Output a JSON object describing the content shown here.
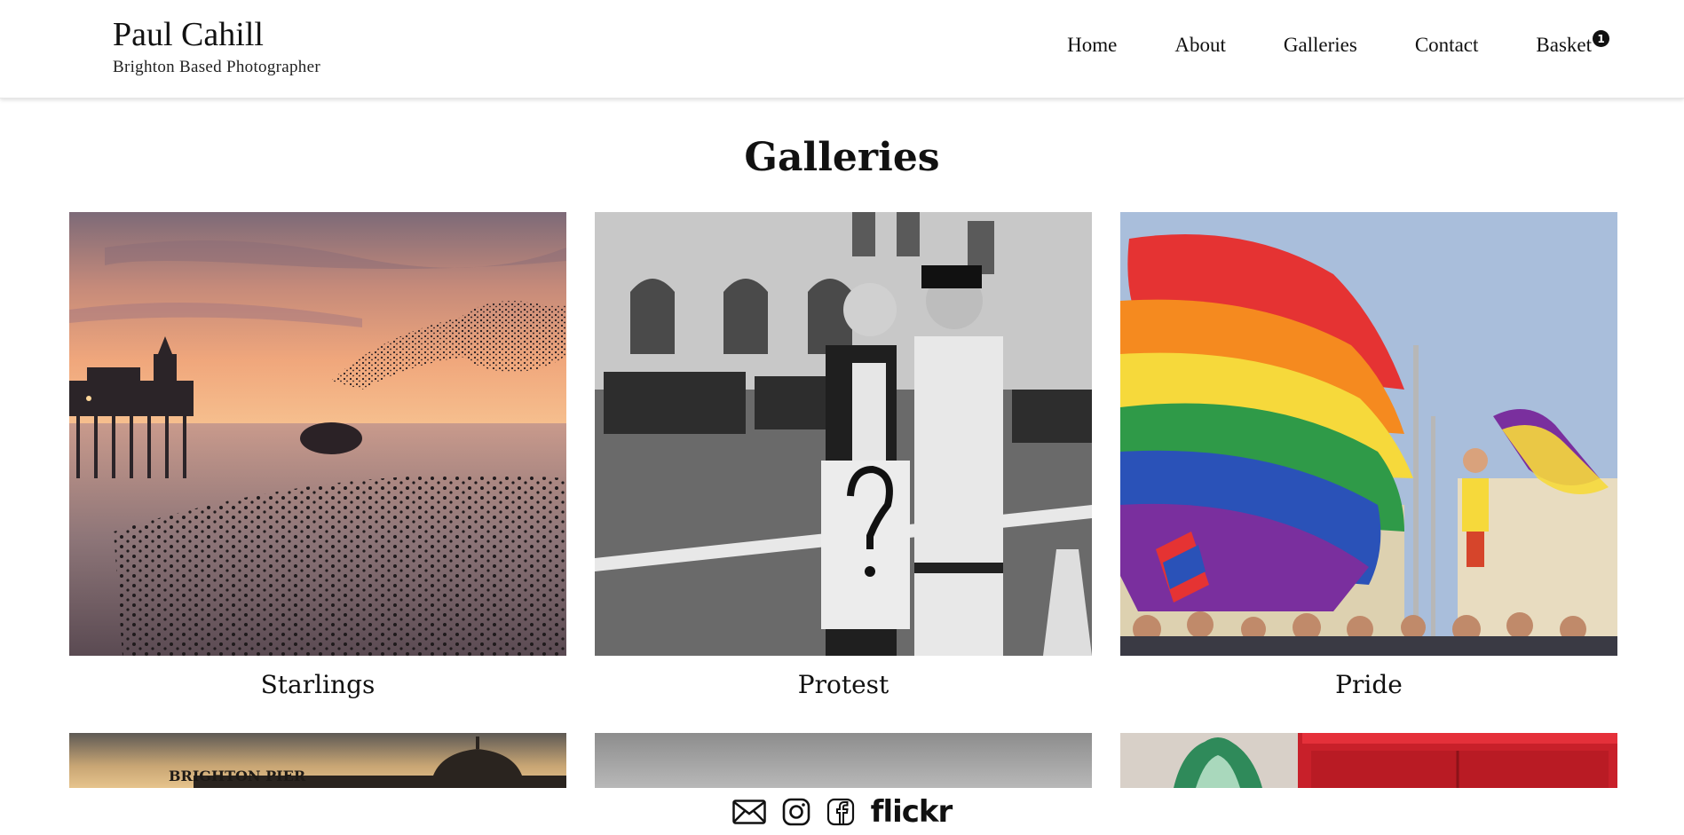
{
  "brand": {
    "name": "Paul Cahill",
    "tagline": "Brighton Based Photographer"
  },
  "nav": [
    {
      "label": "Home"
    },
    {
      "label": "About"
    },
    {
      "label": "Galleries"
    },
    {
      "label": "Contact"
    },
    {
      "label": "Basket",
      "badge": "1"
    }
  ],
  "page": {
    "title": "Galleries"
  },
  "galleries": [
    {
      "caption": "Starlings",
      "image": "sunset-pier-starling-murmuration"
    },
    {
      "caption": "Protest",
      "image": "black-white-protester-with-police"
    },
    {
      "caption": "Pride",
      "image": "rainbow-flag-pride-crowd"
    }
  ],
  "galleries_row2": [
    {
      "image": "brighton-pier-silhouette",
      "sign": "BRIGHTON PIER"
    },
    {
      "image": "grey-sky"
    },
    {
      "image": "red-wall-mural"
    }
  ],
  "footer": {
    "icons": [
      "envelope-icon",
      "instagram-icon",
      "facebook-icon"
    ],
    "flickr": "flickr"
  },
  "colors": {
    "text": "#111111",
    "background": "#ffffff",
    "badge": "#111111"
  }
}
